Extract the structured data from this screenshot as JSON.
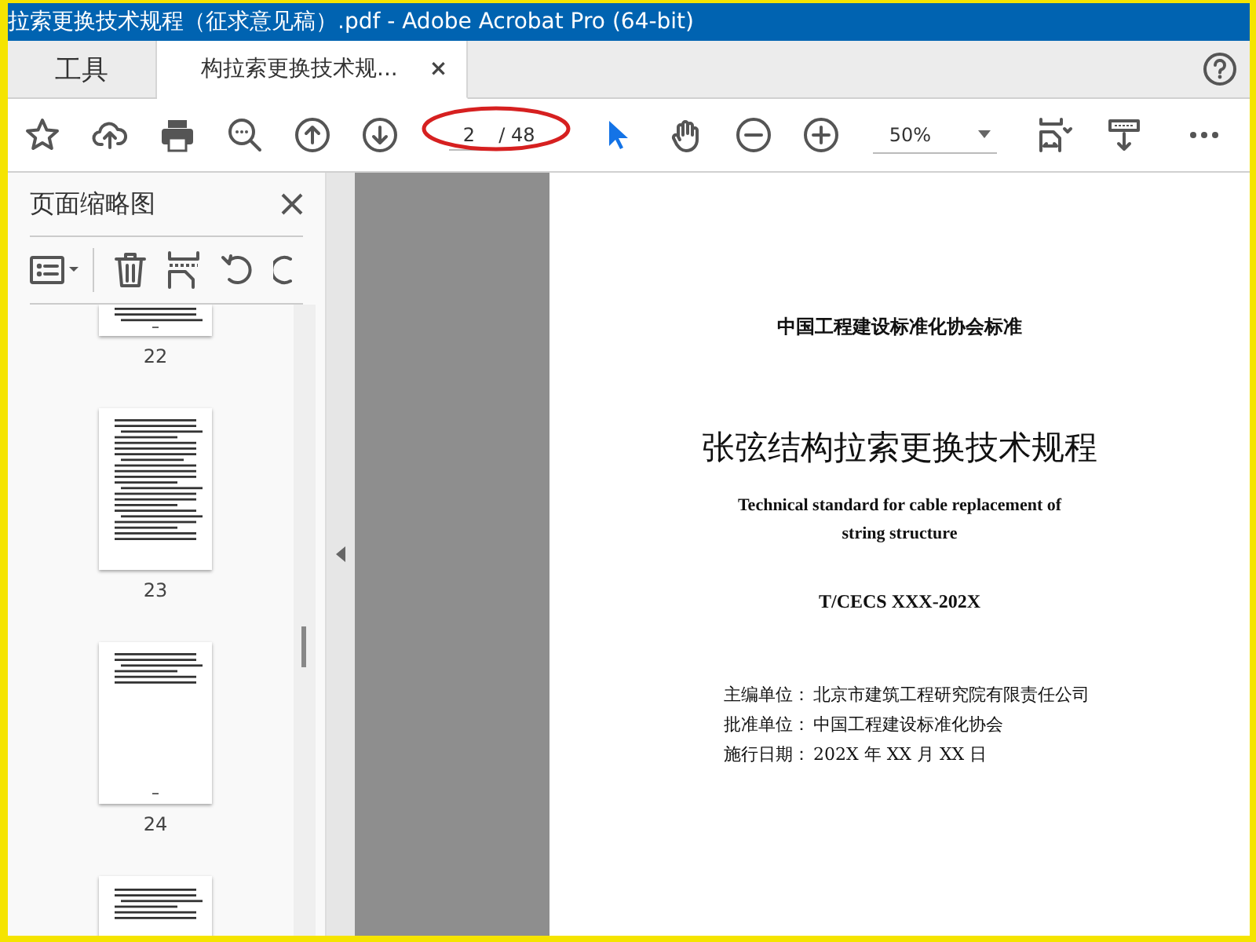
{
  "window": {
    "title": "拉索更换技术规程（征求意见稿）.pdf - Adobe Acrobat Pro (64-bit)"
  },
  "tabs": [
    {
      "label": "工具",
      "kind": "tools",
      "selected": false
    },
    {
      "label": "构拉索更换技术规...",
      "kind": "document",
      "selected": true,
      "close": "×"
    }
  ],
  "toolbar": {
    "page_current": "2",
    "page_total": "/ 48",
    "zoom": "50%"
  },
  "thumbnail_panel": {
    "title": "页面缩略图",
    "pages": [
      {
        "label": "22",
        "kind": "tail"
      },
      {
        "label": "23",
        "kind": "dense"
      },
      {
        "label": "24",
        "kind": "sparse"
      },
      {
        "kind": "head"
      }
    ]
  },
  "document": {
    "header": "中国工程建设标准化协会标准",
    "title": "张弦结构拉索更换技术规程",
    "subtitle_lines": [
      "Technical standard for cable replacement of",
      "string structure"
    ],
    "code": "T/CECS XXX-202X",
    "details": [
      {
        "label": "主编单位：",
        "value": "北京市建筑工程研究院有限责任公司"
      },
      {
        "label": "批准单位：",
        "value": "中国工程建设标准化协会"
      },
      {
        "label": "施行日期：",
        "value": "202X 年 XX 月 XX 日"
      }
    ]
  }
}
